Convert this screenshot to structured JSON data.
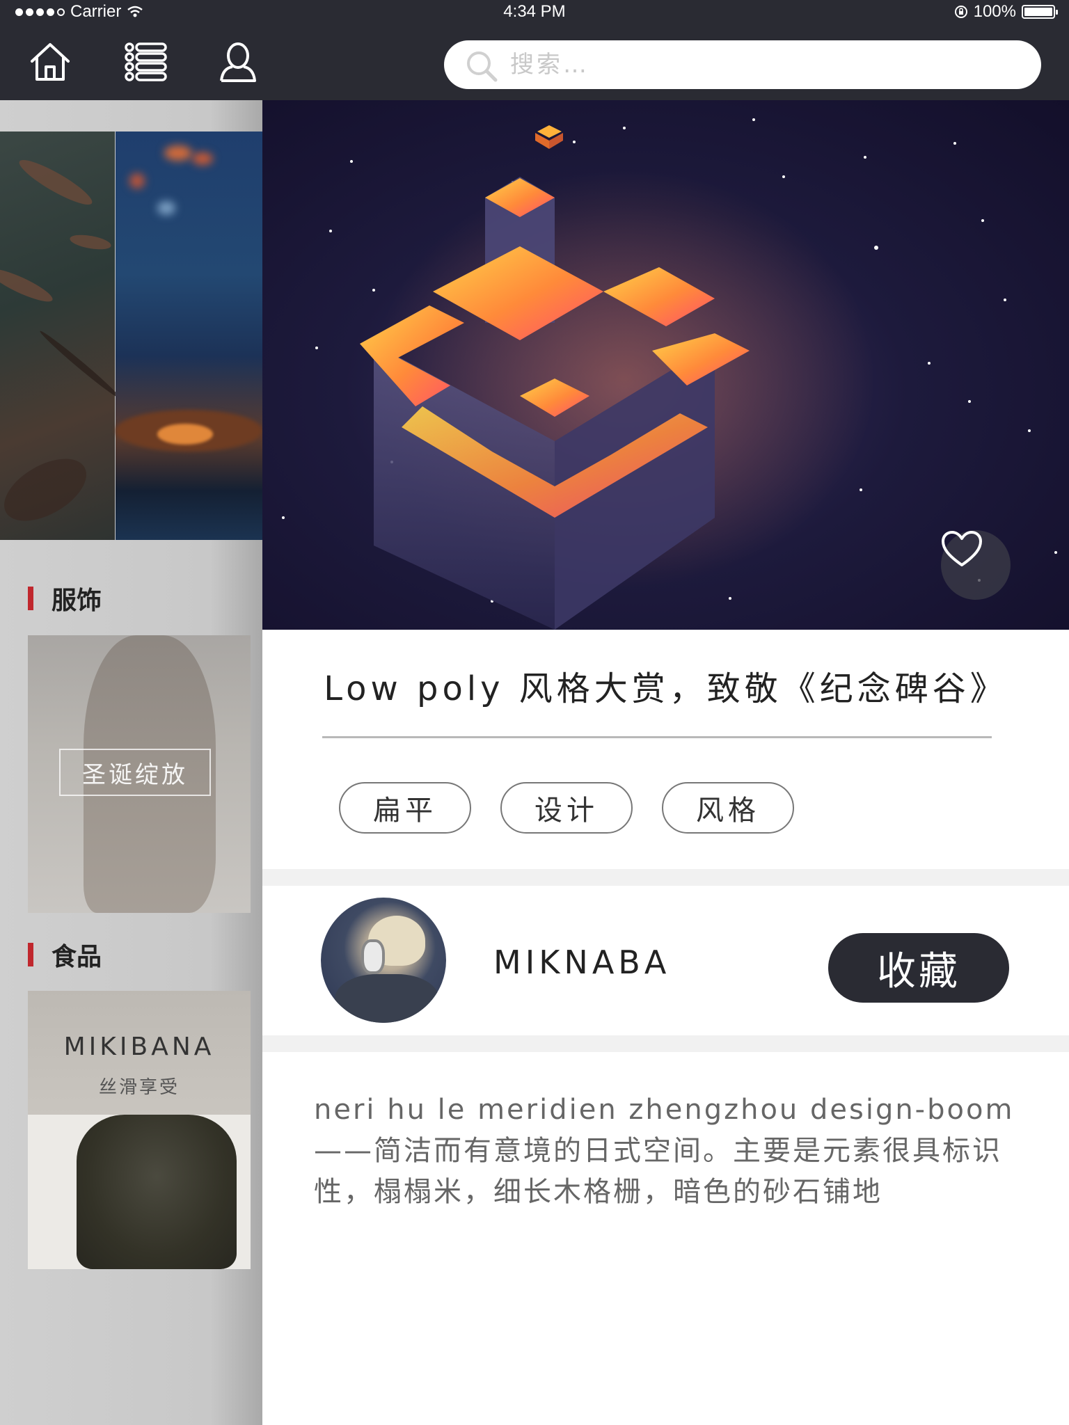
{
  "status_bar": {
    "carrier": "Carrier",
    "time": "4:34 PM",
    "battery": "100%"
  },
  "nav": {
    "icons": [
      "home-icon",
      "list-icon",
      "user-icon"
    ],
    "search_placeholder": "搜索…"
  },
  "sidebar": {
    "sections": [
      {
        "title": "服饰",
        "card_tag": "圣诞绽放"
      },
      {
        "title": "食品",
        "card_brand": "MIKIBANA",
        "card_sub": "丝滑享受"
      }
    ]
  },
  "article": {
    "title": "Low poly 风格大赏，致敬《纪念碑谷》",
    "tags": [
      "扁平",
      "设计",
      "风格"
    ],
    "author": "MIKNABA",
    "collect_label": "收藏",
    "description": "neri hu le meridien zhengzhou design-boom——简洁而有意境的日式空间。主要是元素很具标识性，榻榻米，细长木格栅，暗色的砂石铺地"
  },
  "colors": {
    "nav_bg": "#2a2b33",
    "accent_red": "#c0272d",
    "button_dark": "#2a2b33"
  }
}
